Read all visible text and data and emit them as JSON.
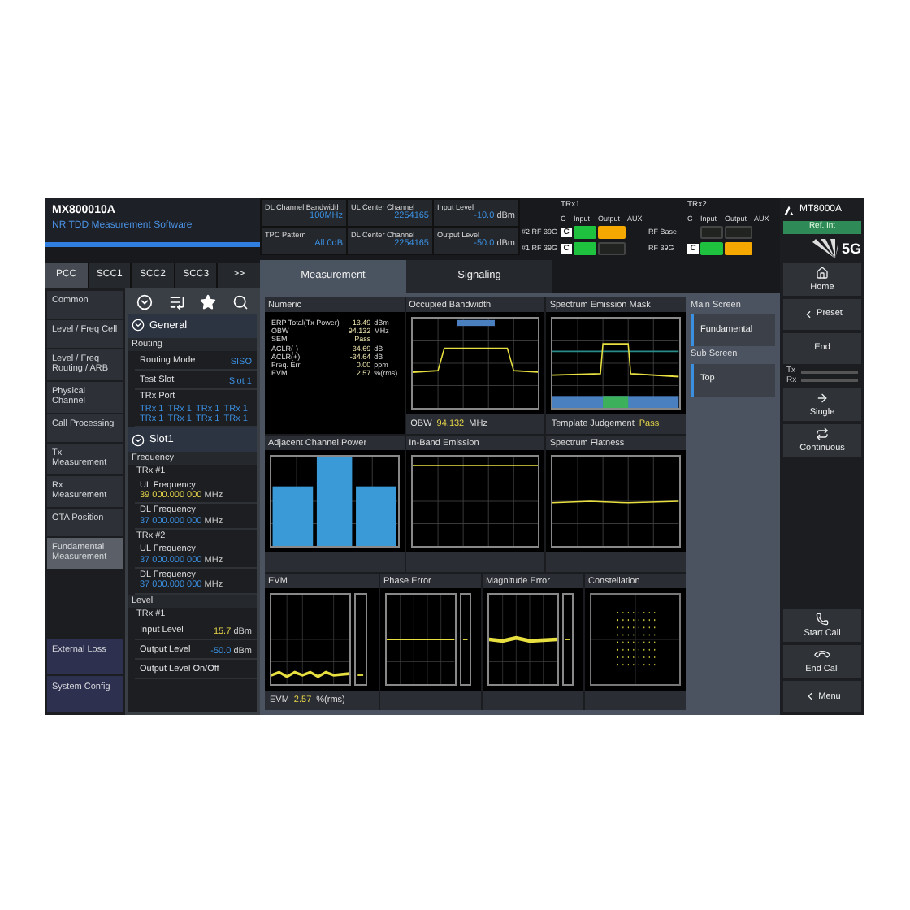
{
  "app": {
    "model": "MX800010A",
    "subtitle": "NR TDD Measurement Software"
  },
  "carrier_tabs": [
    {
      "label": "PCC",
      "selected": true
    },
    {
      "label": "SCC1",
      "selected": false
    },
    {
      "label": "SCC2",
      "selected": false
    },
    {
      "label": "SCC3",
      "selected": false
    },
    {
      "label": ">>",
      "selected": false
    }
  ],
  "nav": [
    {
      "label": "Common",
      "selected": false
    },
    {
      "label": "Level / Freq Cell",
      "selected": false
    },
    {
      "label": "Level / Freq Routing / ARB",
      "selected": false
    },
    {
      "label": "Physical Channel",
      "selected": false
    },
    {
      "label": "Call Processing",
      "selected": false
    },
    {
      "label": "Tx Measurement",
      "selected": false
    },
    {
      "label": "Rx Measurement",
      "selected": false
    },
    {
      "label": "OTA Position",
      "selected": false
    },
    {
      "label": "Fundamental Measurement",
      "selected": true
    }
  ],
  "nav_bottom": [
    {
      "label": "External Loss"
    },
    {
      "label": "System Config"
    }
  ],
  "settings": [
    {
      "kind": "heading",
      "label": "General"
    },
    {
      "kind": "group",
      "label": "Routing"
    },
    {
      "kind": "field",
      "label": "Routing Mode",
      "value": "SISO",
      "highlighted": false
    },
    {
      "kind": "field",
      "label": "Test Slot",
      "value": "Slot 1",
      "highlighted": false
    },
    {
      "kind": "ports",
      "label": "TRx Port",
      "values": [
        "TRx 1",
        "TRx 1",
        "TRx 1",
        "TRx 1",
        "TRx 1",
        "TRx 1",
        "TRx 1",
        "TRx 1"
      ]
    },
    {
      "kind": "heading",
      "label": "Slot1"
    },
    {
      "kind": "group",
      "label": "Frequency"
    },
    {
      "kind": "subgroup",
      "label": "TRx #1"
    },
    {
      "kind": "field",
      "label": "UL Frequency",
      "value": "39 000.000 000",
      "unit": "MHz",
      "highlighted": true
    },
    {
      "kind": "field",
      "label": "DL Frequency",
      "value": "37 000.000 000",
      "unit": "MHz",
      "highlighted": false
    },
    {
      "kind": "subgroup",
      "label": "TRx #2"
    },
    {
      "kind": "field",
      "label": "UL Frequency",
      "value": "37 000.000 000",
      "unit": "MHz",
      "highlighted": false
    },
    {
      "kind": "field",
      "label": "DL Frequency",
      "value": "37 000.000 000",
      "unit": "MHz",
      "highlighted": false
    },
    {
      "kind": "group",
      "label": "Level"
    },
    {
      "kind": "subgroup",
      "label": "TRx #1"
    },
    {
      "kind": "field",
      "label": "Input Level",
      "value": "15.7",
      "unit": "dBm",
      "highlighted": true
    },
    {
      "kind": "field",
      "label": "Output Level",
      "value": "-50.0",
      "unit": "dBm",
      "highlighted": false
    },
    {
      "kind": "field",
      "label": "Output Level On/Off"
    }
  ],
  "parameters": [
    {
      "label": "DL Channel Bandwidth",
      "value": "100MHz"
    },
    {
      "label": "UL Center Channel",
      "value": "2254165"
    },
    {
      "label": "Input Level",
      "value": "-10.0",
      "unit": "dBm"
    },
    {
      "label": "TPC Pattern",
      "value": "All 0dB"
    },
    {
      "label": "DL Center Channel",
      "value": "2254165"
    },
    {
      "label": "Output Level",
      "value": "-50.0",
      "unit": "dBm"
    }
  ],
  "rf_status": [
    {
      "title": "TRx1",
      "headers": [
        "C",
        "Input",
        "Output",
        "AUX"
      ],
      "rows": [
        {
          "label": "#2  RF 39G",
          "badge": "C",
          "input": true,
          "output": true
        },
        {
          "label": "#1  RF 39G",
          "badge": "C",
          "input": true,
          "output": false
        }
      ]
    },
    {
      "title": "TRx2",
      "headers": [
        "C",
        "Input",
        "Output",
        "AUX"
      ],
      "rows": [
        {
          "label": "RF Base",
          "input": false,
          "output": false
        },
        {
          "label": "RF 39G",
          "badge": "C",
          "input": true,
          "output": true
        }
      ]
    }
  ],
  "screen_tabs": [
    {
      "label": "Measurement",
      "selected": true
    },
    {
      "label": "Signaling",
      "selected": false
    }
  ],
  "panels": [
    {
      "kind": "numeric",
      "title": "Numeric",
      "rows": [
        {
          "name": "ERP Total(Tx Power)",
          "value": "13.49",
          "unit": "dBm"
        },
        {
          "name": "OBW",
          "value": "94.132",
          "unit": "MHz"
        },
        {
          "name": "SEM",
          "value": "Pass"
        },
        {
          "name": "ACLR(-)",
          "value": "-34.69",
          "unit": "dB"
        },
        {
          "name": "ACLR(+)",
          "value": "-34.64",
          "unit": "dB"
        },
        {
          "name": "Freq. Err",
          "value": "0.00",
          "unit": "ppm"
        },
        {
          "name": "EVM",
          "value": "2.57",
          "unit": "%(rms)"
        }
      ]
    },
    {
      "kind": "obw",
      "title": "Occupied Bandwidth",
      "footer": {
        "label": "OBW",
        "value": "94.132",
        "unit": "MHz"
      }
    },
    {
      "kind": "sem",
      "title": "Spectrum Emission Mask",
      "footer": {
        "label": "Template Judgement",
        "value": "Pass"
      }
    },
    {
      "kind": "acp",
      "title": "Adjacent Channel Power"
    },
    {
      "kind": "inband",
      "title": "In-Band Emission"
    },
    {
      "kind": "flatness",
      "title": "Spectrum Flatness"
    }
  ],
  "error_panels": [
    {
      "kind": "evm",
      "title": "EVM",
      "footer": {
        "label": "EVM",
        "value": "2.57",
        "unit": "%(rms)"
      }
    },
    {
      "kind": "phase",
      "title": "Phase Error"
    },
    {
      "kind": "magnitude",
      "title": "Magnitude Error"
    },
    {
      "kind": "constellation",
      "title": "Constellation"
    }
  ],
  "screen_select": [
    {
      "title": "Main Screen",
      "options": [
        {
          "label": "Fundamental",
          "selected": true
        }
      ]
    },
    {
      "title": "Sub Screen",
      "options": [
        {
          "label": "Top",
          "selected": true
        }
      ]
    }
  ],
  "instrument": {
    "model": "MT8000A",
    "reference": "Ref. Int",
    "logo": "5G"
  },
  "controls": [
    {
      "kind": "home",
      "label": "Home"
    },
    {
      "kind": "back",
      "label": "Preset"
    },
    {
      "kind": "plain",
      "label": "End"
    },
    {
      "kind": "lamps",
      "labels": [
        "Tx",
        "Rx"
      ]
    },
    {
      "kind": "single",
      "label": "Single"
    },
    {
      "kind": "repeat",
      "label": "Continuous"
    },
    {
      "kind": "spacer"
    },
    {
      "kind": "call",
      "label": "Start Call"
    },
    {
      "kind": "hangup",
      "label": "End Call"
    },
    {
      "kind": "back",
      "label": "Menu"
    }
  ]
}
